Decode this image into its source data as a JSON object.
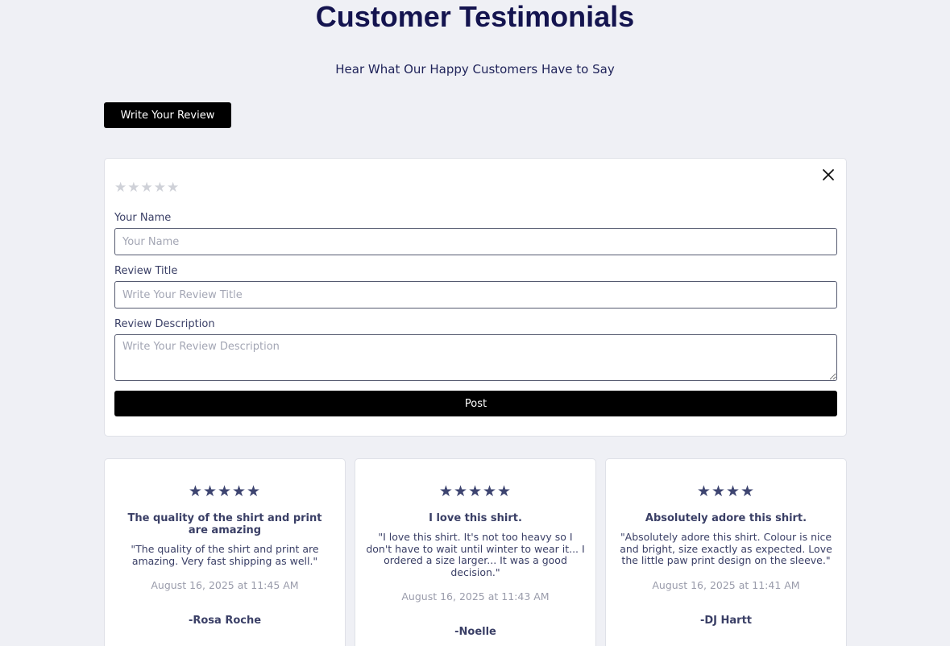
{
  "header": {
    "title": "Customer Testimonials",
    "subtitle": "Hear What Our Happy Customers Have to Say"
  },
  "write_review_button": "Write Your Review",
  "form": {
    "rating_stars": [
      "★",
      "★",
      "★",
      "★",
      "★"
    ],
    "name_label": "Your Name",
    "name_placeholder": "Your Name",
    "title_label": "Review Title",
    "title_placeholder": "Write Your Review Title",
    "description_label": "Review Description",
    "description_placeholder": "Write Your Review Description",
    "post_button": "Post"
  },
  "reviews": [
    {
      "stars": "★★★★★",
      "rating": 5,
      "title": "The quality of the shirt and print are amazing",
      "description": "\"The quality of the shirt and print are amazing. Very fast shipping as well.\"",
      "date": "August 16, 2025 at 11:45 AM",
      "author": "-Rosa Roche"
    },
    {
      "stars": "★★★★★",
      "rating": 5,
      "title": "I love this shirt.",
      "description": "\"I love this shirt. It's not too heavy so I don't have to wait until winter to wear it... I ordered a size larger... It was a good decision.\"",
      "date": "August 16, 2025 at 11:43 AM",
      "author": "-Noelle"
    },
    {
      "stars": "★★★★",
      "rating": 4,
      "title": "Absolutely adore this shirt.",
      "description": "\"Absolutely adore this shirt. Colour is nice and bright, size exactly as expected. Love the little paw print design on the sleeve.\"",
      "date": "August 16, 2025 at 11:41 AM",
      "author": "-DJ Hartt"
    }
  ],
  "colors": {
    "background": "#eff0f5",
    "title": "#14144f",
    "button": "#000000",
    "star_filled": "#3d4470",
    "star_empty": "#cfd1d8"
  }
}
